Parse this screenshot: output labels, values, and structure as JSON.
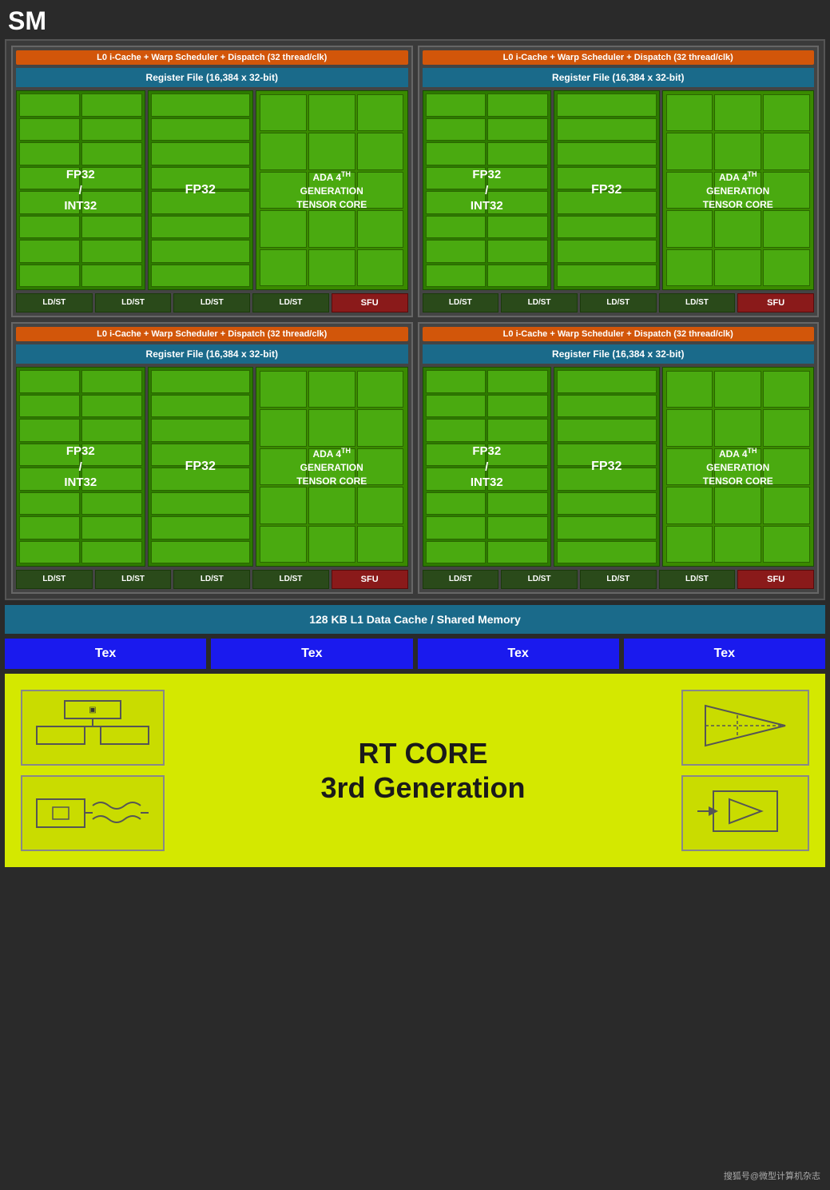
{
  "title": "SM",
  "warp_scheduler": "L0 i-Cache + Warp Scheduler + Dispatch (32 thread/clk)",
  "register_file": "Register File (16,384 x 32-bit)",
  "labels": {
    "fp32_int32": "FP32\n/\nINT32",
    "fp32": "FP32",
    "tensor": "ADA 4th GENERATION TENSOR CORE",
    "tensor_sup": "th",
    "ldst": "LD/ST",
    "sfu": "SFU",
    "l1_cache": "128 KB L1 Data Cache / Shared Memory",
    "tex": "Tex",
    "rt_core_line1": "RT CORE",
    "rt_core_line2": "3rd Generation",
    "watermark": "搜狐号@微型计算机杂志"
  },
  "colors": {
    "orange": "#d2560a",
    "teal": "#1a6a8a",
    "green_dark": "#2d7a00",
    "green_medium": "#3a8a00",
    "green_cell": "#4aaa10",
    "red_sfu": "#8a1a1a",
    "dark_ldst": "#2a4a1a",
    "blue_tex": "#1a1aee",
    "yellow_rt": "#d4e800",
    "bg": "#2a2a2a"
  }
}
